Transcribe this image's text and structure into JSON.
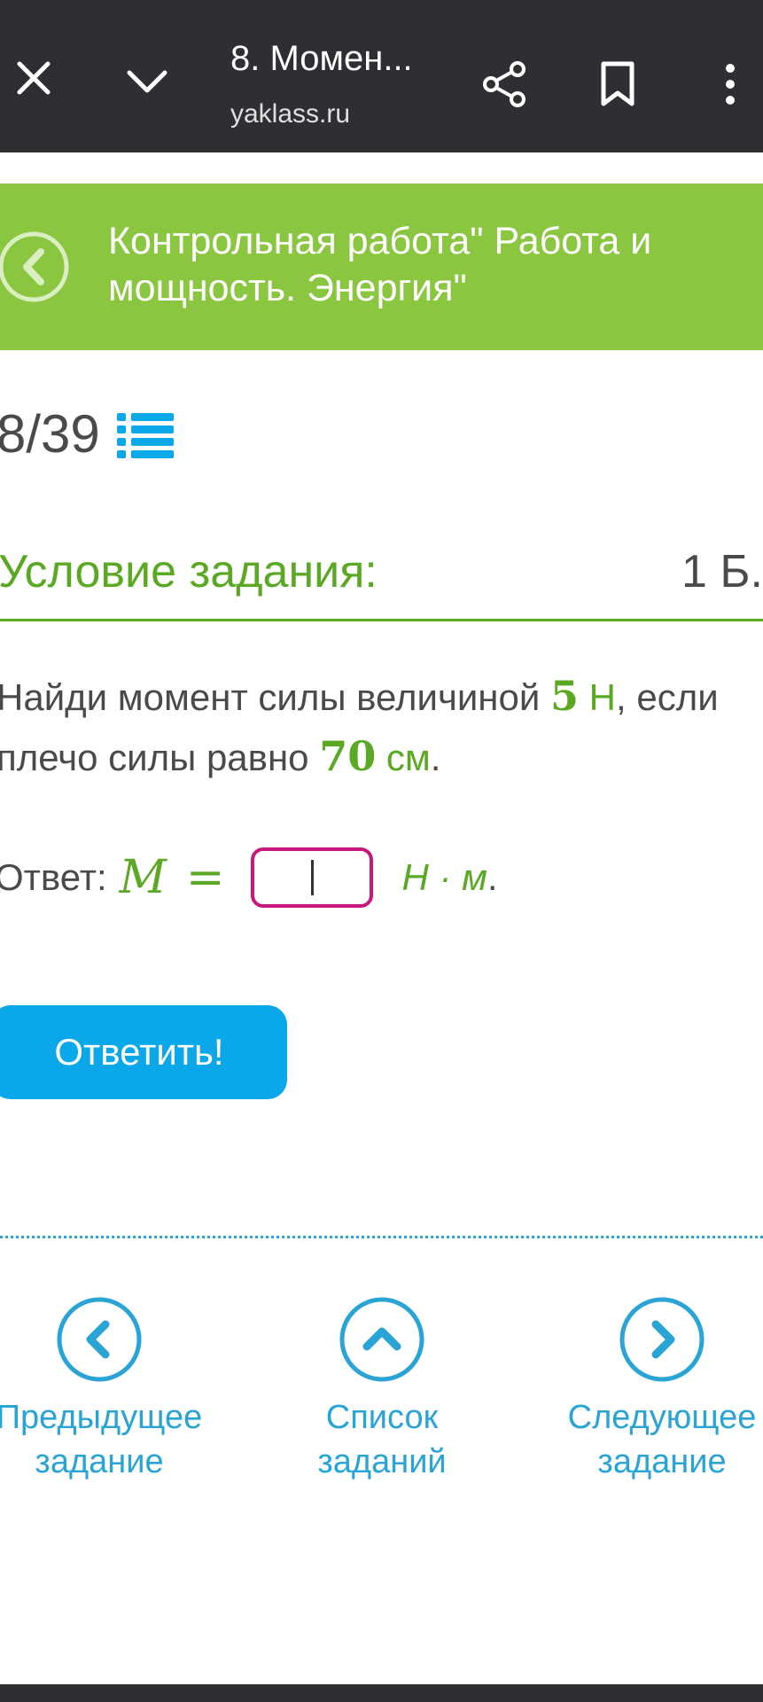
{
  "browser": {
    "tab_title": "8. Момен...",
    "url": "yaklass.ru",
    "icons": [
      "close-icon",
      "chevron-down-icon",
      "share-icon",
      "bookmark-icon",
      "more-vertical-icon"
    ]
  },
  "banner": {
    "title": "Контрольная работа\" Работа и мощность. Энергия\"",
    "color": "#8ac640"
  },
  "progress": {
    "counter": "8/39"
  },
  "condition": {
    "heading": "Условие задания:",
    "points": "1 Б."
  },
  "task": {
    "text_part1": "Найди момент силы величиной ",
    "force_value": "5",
    "force_unit": "Н",
    "text_part2": ", если плечо силы равно ",
    "arm_value": "70",
    "arm_unit": "см",
    "text_end": "."
  },
  "answer": {
    "label": "Ответ:",
    "variable": "M",
    "equals": "=",
    "input_value": "",
    "unit": "Н · м",
    "end": "."
  },
  "submit": {
    "label": "Ответить!"
  },
  "navigation": {
    "prev": {
      "line1": "Предыдущее",
      "line2": "задание"
    },
    "list": {
      "line1": "Список",
      "line2": "заданий"
    },
    "next": {
      "line1": "Следующее",
      "line2": "задание"
    }
  },
  "colors": {
    "accent_green": "#5aa823",
    "accent_blue": "#0aa8e8",
    "link_blue": "#2aa3d5",
    "input_border": "#c6177a",
    "toolbar": "#2e2f33"
  }
}
